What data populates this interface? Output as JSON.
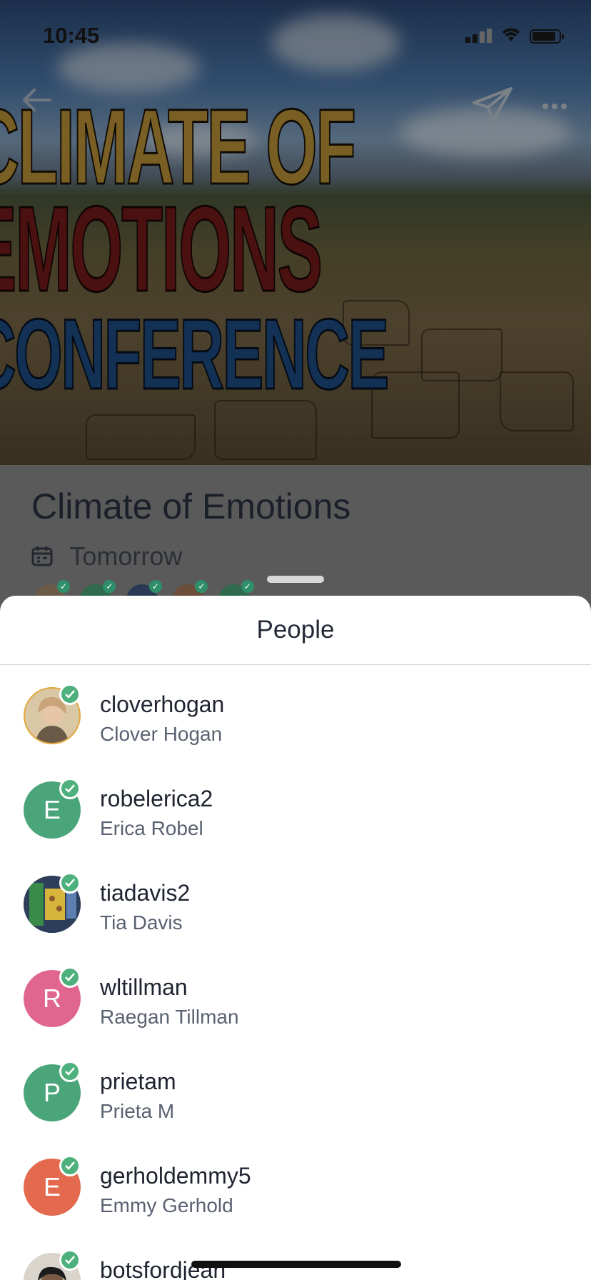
{
  "status_bar": {
    "time": "10:45"
  },
  "hero": {
    "poster_line1": "CLIMATE OF",
    "poster_line2": "EMOTIONS",
    "poster_line3": "CONFERENCE"
  },
  "event": {
    "title": "Climate of Emotions",
    "date": "Tomorrow"
  },
  "sheet": {
    "title": "People",
    "people": [
      {
        "username": "cloverhogan",
        "name": "Clover Hogan",
        "initial": "",
        "color": "#d9c7a6",
        "photo": true
      },
      {
        "username": "robelerica2",
        "name": "Erica Robel",
        "initial": "E",
        "color": "#4aa57a",
        "photo": false
      },
      {
        "username": "tiadavis2",
        "name": "Tia Davis",
        "initial": "",
        "color": "#3b5f8a",
        "photo": true
      },
      {
        "username": "wltillman",
        "name": "Raegan Tillman",
        "initial": "R",
        "color": "#e0668f",
        "photo": false
      },
      {
        "username": "prietam",
        "name": "Prieta M",
        "initial": "P",
        "color": "#4aa57a",
        "photo": false
      },
      {
        "username": "gerholdemmy5",
        "name": "Emmy Gerhold",
        "initial": "E",
        "color": "#e36a4f",
        "photo": false
      },
      {
        "username": "botsfordjean",
        "name": "",
        "initial": "",
        "color": "#c9c4bd",
        "photo": true
      }
    ]
  },
  "icons": {
    "back": "arrow-left-icon",
    "send": "paper-plane-icon",
    "more": "more-horizontal-icon",
    "calendar": "calendar-icon",
    "verified": "check-badge-icon"
  }
}
